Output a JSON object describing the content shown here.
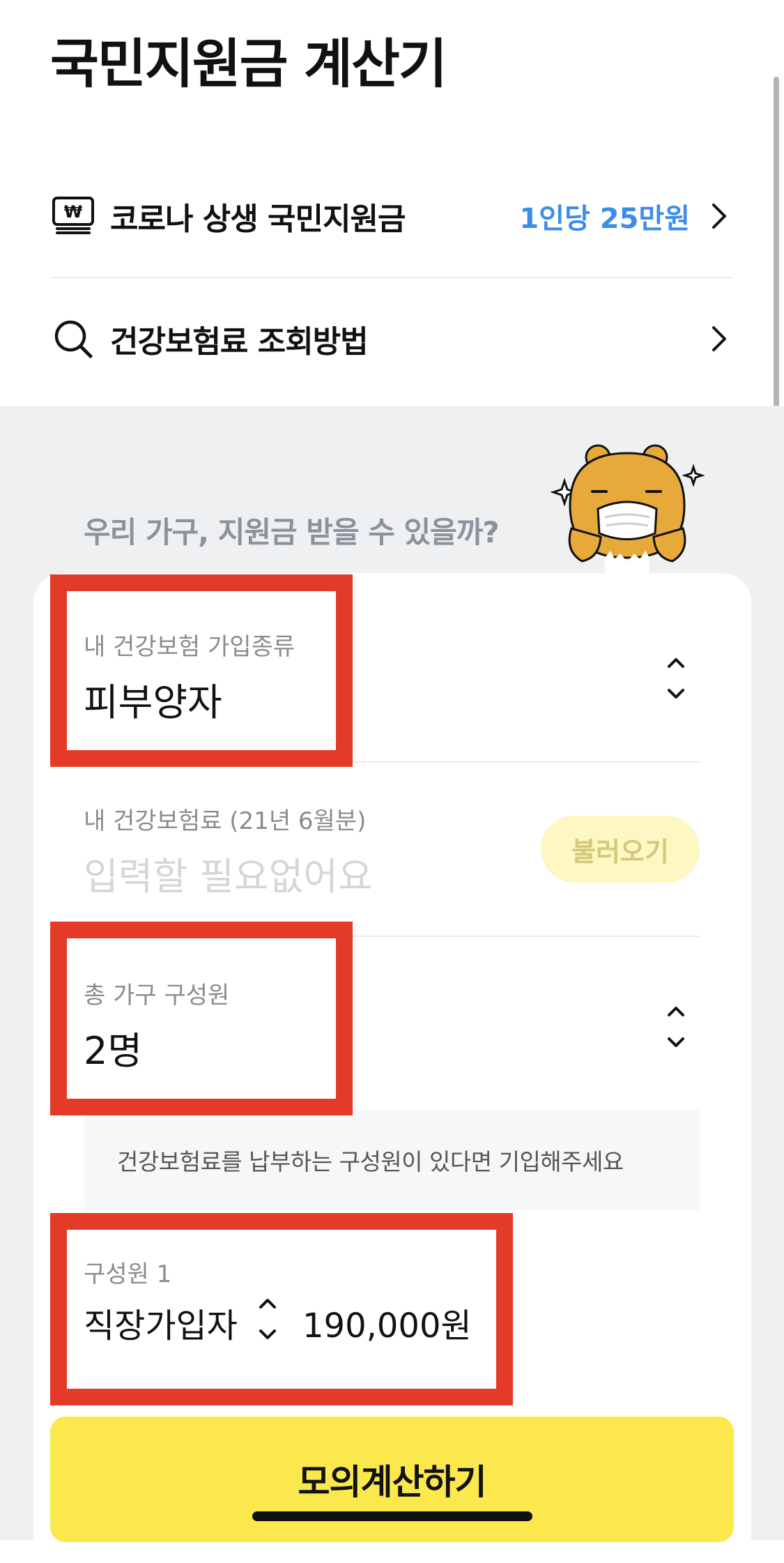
{
  "header": {
    "title": "국민지원금 계산기"
  },
  "links": [
    {
      "label": "코로나 상생 국민지원금",
      "value": "1인당 25만원",
      "icon": "won-card-icon"
    },
    {
      "label": "건강보험료 조회방법",
      "value": "",
      "icon": "search-icon"
    }
  ],
  "question": "우리 가구, 지원금 받을 수 있을까?",
  "form": {
    "insurance_type": {
      "label": "내 건강보험 가입종류",
      "value": "피부양자"
    },
    "premium": {
      "label": "내 건강보험료 (21년 6월분)",
      "placeholder": "입력할 필요없어요",
      "button": "불러오기"
    },
    "household": {
      "label": "총 가구 구성원",
      "value": "2명"
    },
    "notice": "건강보험료를 납부하는 구성원이 있다면 기입해주세요",
    "member": {
      "label": "구성원 1",
      "type": "직장가입자",
      "amount": "190,000원"
    }
  },
  "cta": {
    "label": "모의계산하기"
  },
  "colors": {
    "accent": "#3c8dea",
    "cta": "#fae84c",
    "highlight": "#e33b27",
    "background": "#eef0f2"
  }
}
